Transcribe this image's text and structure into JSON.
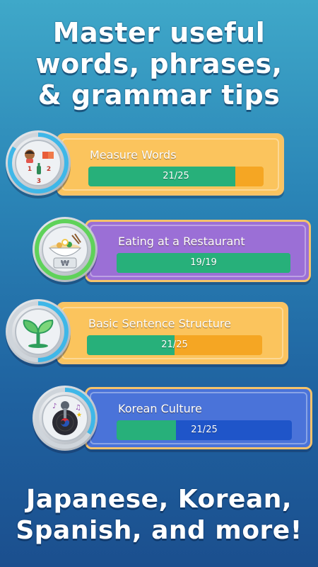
{
  "headline_top": {
    "line1": "Master useful",
    "line2": "words, phrases,",
    "line3": "& grammar tips"
  },
  "headline_bottom": {
    "line1": "Japanese, Korean,",
    "line2": "Spanish, and more!"
  },
  "lessons": [
    {
      "title": "Measure Words",
      "progress_text": "21/25",
      "progress": 0.84,
      "icon": "measure-words-icon",
      "colors": {
        "card": "#fbc45d",
        "bar_bg": "#f5a623",
        "fill": "#27b07a",
        "ring": "#3fb7e8"
      }
    },
    {
      "title": "Eating at a Restaurant",
      "progress_text": "19/19",
      "progress": 1.0,
      "icon": "restaurant-bowl-icon",
      "colors": {
        "card": "#9b6fd6",
        "bar_bg": "#27b07a",
        "fill": "#27b07a",
        "ring": "#5fd25a"
      }
    },
    {
      "title": "Basic Sentence Structure",
      "progress_text": "21/25",
      "progress": 0.5,
      "icon": "sprout-icon",
      "colors": {
        "card": "#fbc45d",
        "bar_bg": "#f5a623",
        "fill": "#27b07a",
        "ring": "#3fb7e8"
      }
    },
    {
      "title": "Korean Culture",
      "progress_text": "21/25",
      "progress": 0.34,
      "icon": "karaoke-record-icon",
      "colors": {
        "card": "#4a73d9",
        "bar_bg": "#1f55c9",
        "fill": "#27b07a",
        "ring": "#3fb7e8"
      }
    }
  ]
}
